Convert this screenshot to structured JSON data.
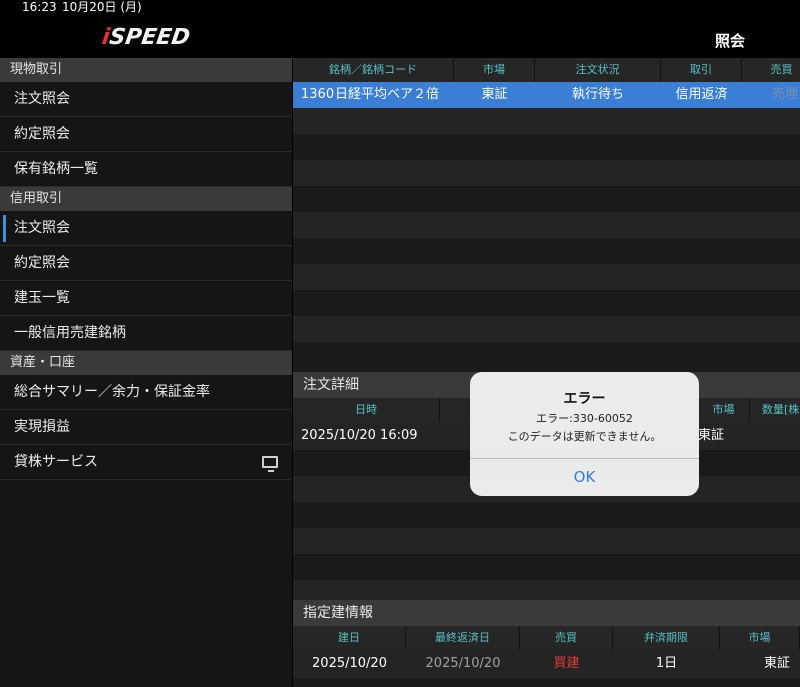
{
  "status": {
    "time": "16:23",
    "date": "10月20日 (月)"
  },
  "header": {
    "logo_i": "i",
    "logo_rest": "SPEED",
    "title": "照会"
  },
  "sidebar": {
    "sections": [
      {
        "title": "現物取引",
        "items": [
          "注文照会",
          "約定照会",
          "保有銘柄一覧"
        ]
      },
      {
        "title": "信用取引",
        "items": [
          "注文照会",
          "約定照会",
          "建玉一覧",
          "一般信用売建銘柄"
        ]
      },
      {
        "title": "資産・口座",
        "items": [
          "総合サマリー／余力・保証金率",
          "実現損益",
          "貸株サービス"
        ]
      }
    ]
  },
  "orders": {
    "columns": [
      "銘柄／銘柄コード",
      "市場",
      "注文状況",
      "取引",
      "売買"
    ],
    "rows": [
      {
        "code": "1360",
        "name": "日経平均ベア２倍",
        "market": "東証",
        "status": "執行待ち",
        "trade": "信用返済",
        "side": "売埋"
      }
    ]
  },
  "detail": {
    "title": "注文詳細",
    "columns": [
      "日時",
      "",
      "市場",
      "数量[株]"
    ],
    "rows": [
      {
        "datetime": "2025/10/20 16:09",
        "mid": "",
        "market": "東証"
      }
    ]
  },
  "specified": {
    "title": "指定建情報",
    "columns": [
      "建日",
      "最終返済日",
      "売買",
      "弁済期限",
      "市場"
    ],
    "rows": [
      {
        "open_date": "2025/10/20",
        "last_date": "2025/10/20",
        "side": "買建",
        "deadline": "1日",
        "market": "東証"
      }
    ]
  },
  "dialog": {
    "title": "エラー",
    "code": "エラー:330-60052",
    "message": "このデータは更新できません。",
    "ok": "OK"
  },
  "colors": {
    "accent": "#3a7fd5",
    "header_text": "#56c2c8",
    "sell_red": "#e53a3a"
  }
}
